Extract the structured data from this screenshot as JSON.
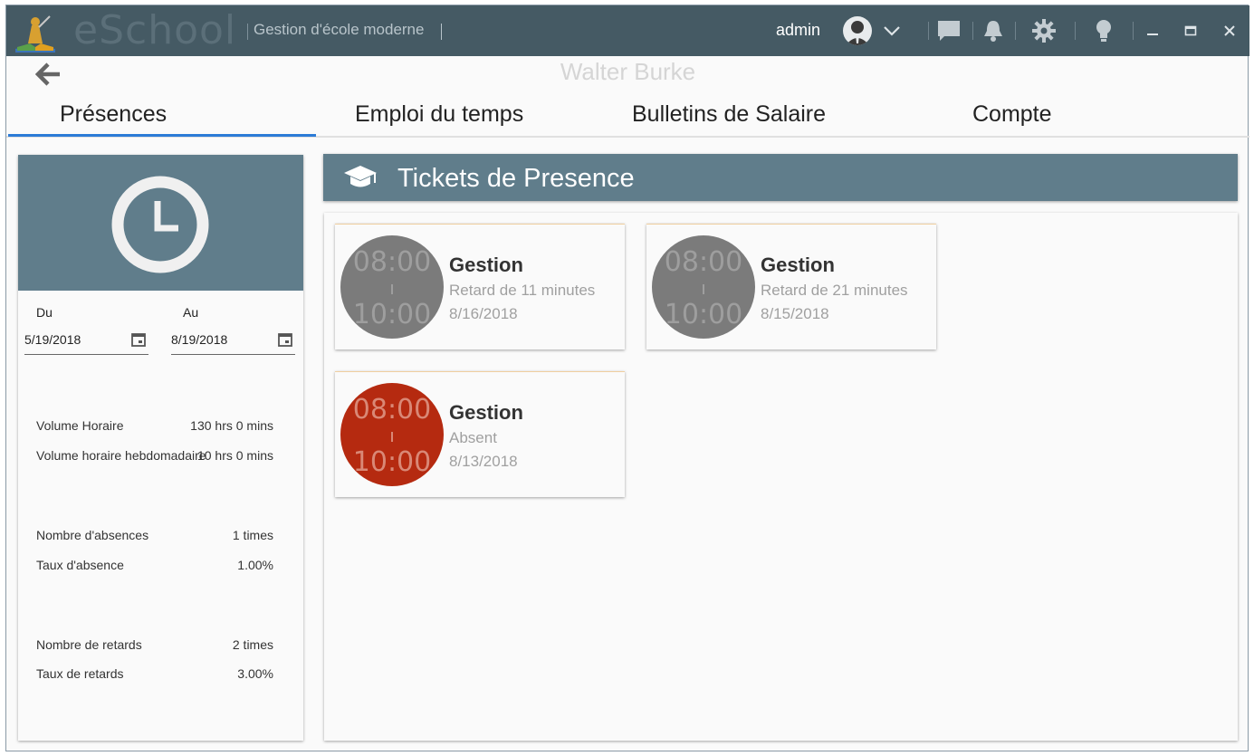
{
  "app": {
    "brand": "eSchool",
    "tagline": "Gestion d'école moderne",
    "user": "admin"
  },
  "header": {
    "person_name": "Walter Burke"
  },
  "tabs": [
    {
      "label": "Présences",
      "active": true
    },
    {
      "label": "Emploi du temps",
      "active": false
    },
    {
      "label": "Bulletins de Salaire",
      "active": false
    },
    {
      "label": "Compte",
      "active": false
    }
  ],
  "filter": {
    "from_label": "Du",
    "from_value": "5/19/2018",
    "to_label": "Au",
    "to_value": "8/19/2018"
  },
  "stats": {
    "volume_horaire_label": "Volume Horaire",
    "volume_horaire_value": "130 hrs 0 mins",
    "volume_hebdo_label": "Volume horaire hebdomadaire",
    "volume_hebdo_value": "10 hrs 0 mins",
    "absences_label": "Nombre d'absences",
    "absences_value": "1 times",
    "taux_absence_label": "Taux d'absence",
    "taux_absence_value": "1.00%",
    "retards_label": "Nombre de retards",
    "retards_value": "2 times",
    "taux_retards_label": "Taux de retards",
    "taux_retards_value": "3.00%"
  },
  "tickets_panel": {
    "title": "Tickets de Presence"
  },
  "tickets": [
    {
      "start": "08:00",
      "end": "10:00",
      "subject": "Gestion",
      "status": "Retard de 11 minutes",
      "date": "8/16/2018",
      "circle_color": "#7b7b7b"
    },
    {
      "start": "08:00",
      "end": "10:00",
      "subject": "Gestion",
      "status": "Retard de 21 minutes",
      "date": "8/15/2018",
      "circle_color": "#7b7b7b"
    },
    {
      "start": "08:00",
      "end": "10:00",
      "subject": "Gestion",
      "status": "Absent",
      "date": "8/13/2018",
      "circle_color": "#b52a10"
    }
  ],
  "colors": {
    "titlebar": "#455a64",
    "panel_header": "#607d8b",
    "tab_accent": "#2c7bd6"
  },
  "icons": [
    "app-logo-icon",
    "avatar-icon",
    "chevron-down-icon",
    "chat-icon",
    "bell-icon",
    "gear-icon",
    "lightbulb-icon",
    "minimize-icon",
    "maximize-icon",
    "close-icon",
    "back-arrow-icon",
    "clock-icon",
    "calendar-icon",
    "graduation-cap-icon"
  ]
}
